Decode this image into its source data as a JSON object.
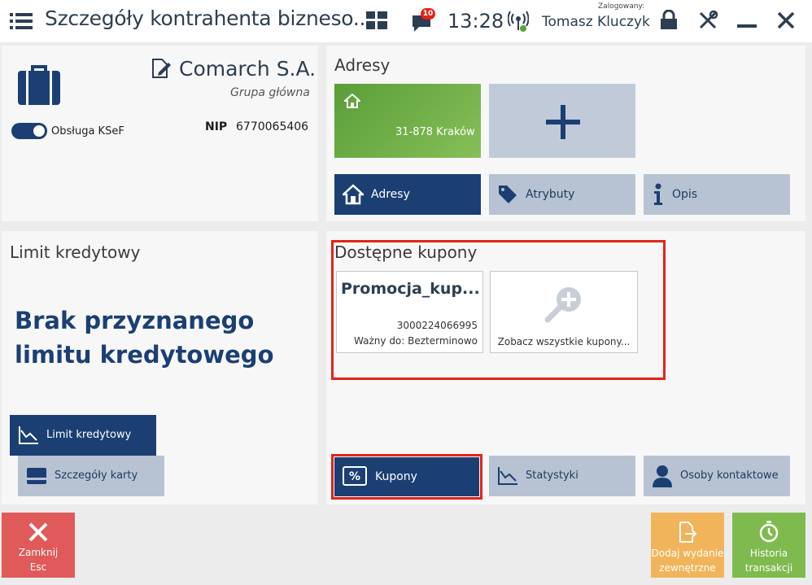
{
  "header": {
    "title": "Szczegóły kontrahenta bizneso...",
    "notification_count": "10",
    "time": "13:28",
    "logged_label": "Zalogowany:",
    "user_name": "Tomasz Kluczyk"
  },
  "customer": {
    "name": "Comarch S.A.",
    "group": "Grupa główna",
    "ksef_label": "Obsługa KSeF",
    "nip_label": "NIP",
    "nip_value": "6770065406"
  },
  "addresses": {
    "title": "Adresy",
    "tile_text": "31-878 Kraków"
  },
  "top_tabs": [
    {
      "label": "Adresy",
      "icon": "house-icon"
    },
    {
      "label": "Atrybuty",
      "icon": "tag-icon"
    },
    {
      "label": "Opis",
      "icon": "info-icon"
    }
  ],
  "credit": {
    "title": "Limit kredytowy",
    "message": "Brak przyznanego limitu kredytowego",
    "btn_limit": "Limit kredytowy",
    "btn_card": "Szczegóły karty"
  },
  "coupons": {
    "title": "Dostępne kupony",
    "items": [
      {
        "name": "Promocja_kup...",
        "code": "3000224066995",
        "valid": "Ważny do: Bezterminowo"
      }
    ],
    "see_all": "Zobacz wszystkie kupony..."
  },
  "bottom_tabs": [
    {
      "label": "Kupony",
      "icon": "percent-icon"
    },
    {
      "label": "Statystyki",
      "icon": "chart-icon"
    },
    {
      "label": "Osoby kontaktowe",
      "icon": "person-icon"
    }
  ],
  "actions": {
    "close_l1": "Zamknij",
    "close_l2": "Esc",
    "add_l1": "Dodaj wydanie",
    "add_l2": "zewnętrzne",
    "history_l1": "Historia",
    "history_l2": "transakcji"
  },
  "colors": {
    "primary": "#1b3f73",
    "light_tile": "#b7c3d2",
    "address_tile": "#6aaa44",
    "highlight": "#e2231a",
    "close": "#e05a5a",
    "add_external": "#f2b45a",
    "history": "#7fba4e"
  }
}
